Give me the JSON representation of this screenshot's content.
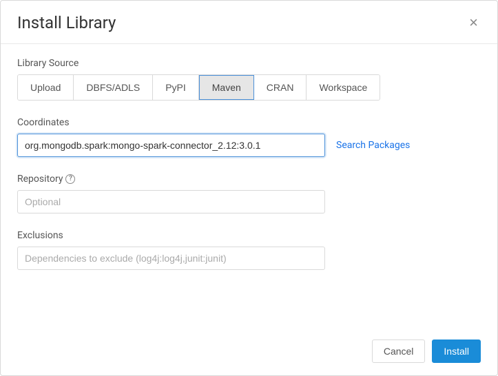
{
  "modal": {
    "title": "Install Library"
  },
  "librarySource": {
    "label": "Library Source",
    "tabs": [
      {
        "label": "Upload"
      },
      {
        "label": "DBFS/ADLS"
      },
      {
        "label": "PyPI"
      },
      {
        "label": "Maven"
      },
      {
        "label": "CRAN"
      },
      {
        "label": "Workspace"
      }
    ]
  },
  "coordinates": {
    "label": "Coordinates",
    "value": "org.mongodb.spark:mongo-spark-connector_2.12:3.0.1",
    "searchLink": "Search Packages"
  },
  "repository": {
    "label": "Repository",
    "placeholder": "Optional"
  },
  "exclusions": {
    "label": "Exclusions",
    "placeholder": "Dependencies to exclude (log4j:log4j,junit:junit)"
  },
  "footer": {
    "cancel": "Cancel",
    "install": "Install"
  }
}
